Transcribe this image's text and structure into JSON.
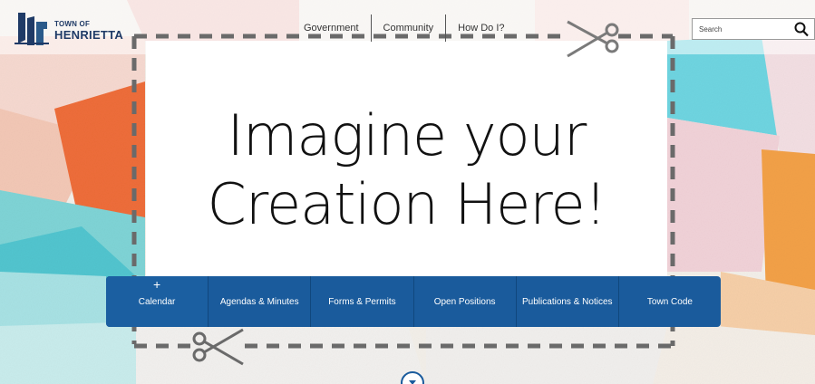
{
  "header": {
    "logo": {
      "small_text": "TOWN OF",
      "big_text": "HENRIETTA"
    },
    "nav": [
      {
        "label": "Government"
      },
      {
        "label": "Community"
      },
      {
        "label": "How Do I?"
      }
    ],
    "search": {
      "placeholder": "Search",
      "icon": "search-icon"
    }
  },
  "hero": {
    "headline_line1": "Imagine your",
    "headline_line2": "Creation Here!"
  },
  "quick_links": [
    {
      "label": "Calendar",
      "icon": "plus-icon"
    },
    {
      "label": "Agendas & Minutes"
    },
    {
      "label": "Forms & Permits"
    },
    {
      "label": "Open Positions"
    },
    {
      "label": "Publications & Notices"
    },
    {
      "label": "Town Code"
    }
  ],
  "colors": {
    "brand_blue": "#1a5b9c",
    "logo_navy": "#1f3a66",
    "dash_gray": "#6a6a6a"
  }
}
